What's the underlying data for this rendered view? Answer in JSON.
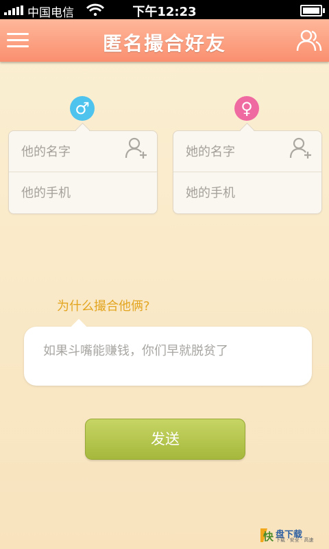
{
  "status_bar": {
    "carrier": "中国电信",
    "time": "下午12:23"
  },
  "header": {
    "title": "匿名撮合好友"
  },
  "male_card": {
    "gender_symbol": "♂",
    "name_placeholder": "他的名字",
    "phone_placeholder": "他的手机"
  },
  "female_card": {
    "gender_symbol": "♀",
    "name_placeholder": "她的名字",
    "phone_placeholder": "她的手机"
  },
  "reason": {
    "question": "为什么撮合他俩?",
    "text": "如果斗嘴能赚钱，你们早就脱贫了"
  },
  "send_button": {
    "label": "发送"
  },
  "watermark": {
    "logo_char": "快",
    "brand": "盘下载",
    "slogan": "下载 · 安全 · 高速"
  },
  "colors": {
    "header": "#f98f6f",
    "male": "#4ec3ee",
    "female": "#f06aa2",
    "send": "#a6b83c",
    "question": "#e3a520"
  }
}
